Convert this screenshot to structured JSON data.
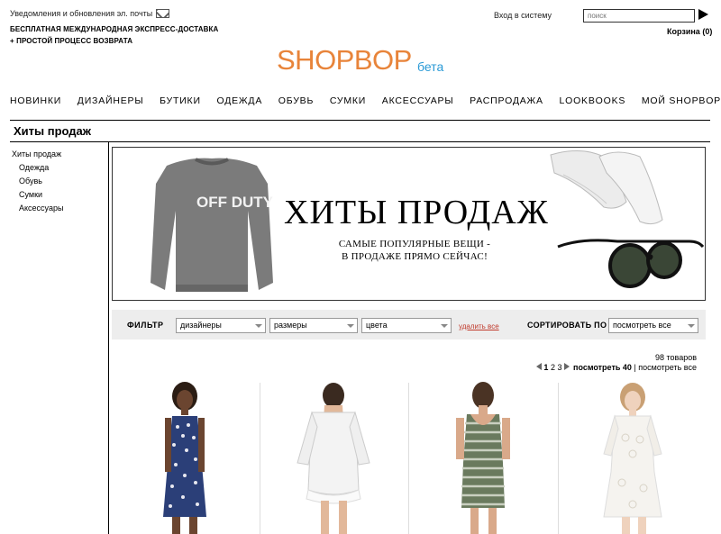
{
  "topbar": {
    "notifications_label": "Уведомления и обновления эл. почты",
    "promo_line1": "БЕСПЛАТНАЯ МЕЖДУНАРОДНАЯ ЭКСПРЕСС-ДОСТАВКА",
    "promo_line2": "+ ПРОСТОЙ ПРОЦЕСС ВОЗВРАТА",
    "login_label": "Вход в систему",
    "search_placeholder": "поиск",
    "cart_label": "Корзина (0)"
  },
  "logo": {
    "text": "SHOPBOP",
    "beta": "бета",
    "color": "#e8843a",
    "beta_color": "#2a9ad6"
  },
  "nav": [
    "НОВИНКИ",
    "ДИЗАЙНЕРЫ",
    "БУТИКИ",
    "ОДЕЖДА",
    "ОБУВЬ",
    "СУМКИ",
    "АКСЕССУАРЫ",
    "РАСПРОДАЖА",
    "LOOKBOOKS",
    "МОЙ SHOPBOP"
  ],
  "page_title": "Хиты продаж",
  "sidebar": {
    "heading": "Хиты продаж",
    "items": [
      "Одежда",
      "Обувь",
      "Сумки",
      "Аксессуары"
    ]
  },
  "banner": {
    "title": "ХИТЫ ПРОДАЖ",
    "subtitle_line1": "САМЫЕ ПОПУЛЯРНЫЕ ВЕЩИ -",
    "subtitle_line2": "В ПРОДАЖЕ ПРЯМО СЕЙЧАС!",
    "sweatshirt_text": "OFF DUTY"
  },
  "filter": {
    "label": "ФИЛЬТР",
    "designers": "дизайнеры",
    "sizes": "размеры",
    "colors": "цвета",
    "clear": "удалить все",
    "sort_label": "СОРТИРОВАТЬ ПО",
    "sort_value": "посмотреть все"
  },
  "results": {
    "count": "98 товаров",
    "pages": [
      "1",
      "2",
      "3"
    ],
    "view_40": "посмотреть 40",
    "divider": "|",
    "view_all": "посмотреть все"
  },
  "products": [
    {
      "name": "navy-polka-dot-dress",
      "color": "#2b3f78"
    },
    {
      "name": "white-cold-shoulder-dress",
      "color": "#f2f2f2"
    },
    {
      "name": "striped-green-dress",
      "color": "#6a7a5e"
    },
    {
      "name": "white-lace-dress",
      "color": "#f5f3ef"
    }
  ]
}
